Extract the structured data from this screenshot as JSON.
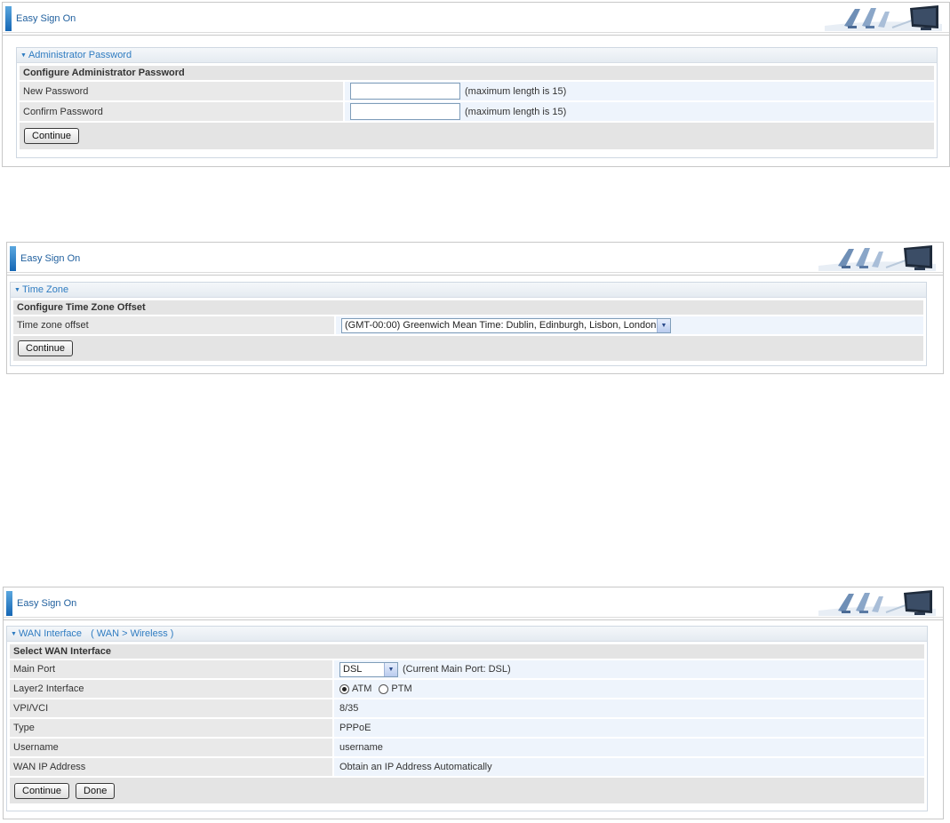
{
  "panel1": {
    "header_title": "Easy Sign On",
    "section_title": "Administrator Password",
    "config_title": "Configure Administrator Password",
    "rows": [
      {
        "label": "New Password",
        "value": "",
        "note": "(maximum length is 15)"
      },
      {
        "label": "Confirm Password",
        "value": "",
        "note": "(maximum length is 15)"
      }
    ],
    "continue_label": "Continue"
  },
  "panel2": {
    "header_title": "Easy Sign On",
    "section_title": "Time Zone",
    "config_title": "Configure Time Zone Offset",
    "tz_label": "Time zone offset",
    "tz_selected": "(GMT-00:00) Greenwich Mean Time: Dublin, Edinburgh, Lisbon, London",
    "continue_label": "Continue"
  },
  "panel3": {
    "header_title": "Easy Sign On",
    "section_title": "WAN Interface",
    "breadcrumb": "( WAN > Wireless )",
    "config_title": "Select WAN Interface",
    "main_port_label": "Main Port",
    "main_port_selected": "DSL",
    "main_port_note": "(Current Main Port: DSL)",
    "layer2_label": "Layer2 Interface",
    "layer2_options": [
      {
        "label": "ATM",
        "selected": true
      },
      {
        "label": "PTM",
        "selected": false
      }
    ],
    "vpi_label": "VPI/VCI",
    "vpi_value": "8/35",
    "type_label": "Type",
    "type_value": "PPPoE",
    "username_label": "Username",
    "username_value": "username",
    "wanip_label": "WAN IP Address",
    "wanip_value": "Obtain an IP Address Automatically",
    "continue_label": "Continue",
    "done_label": "Done"
  },
  "icons": {
    "header_art": "office-chairs-monitor-icon",
    "section_toggle": "triangle-down-icon",
    "select_arrow": "chevron-down-icon"
  },
  "colors": {
    "accent": "#2f7cc1",
    "header_bar": "#1566b4",
    "value_cell": "#eef4fc"
  }
}
